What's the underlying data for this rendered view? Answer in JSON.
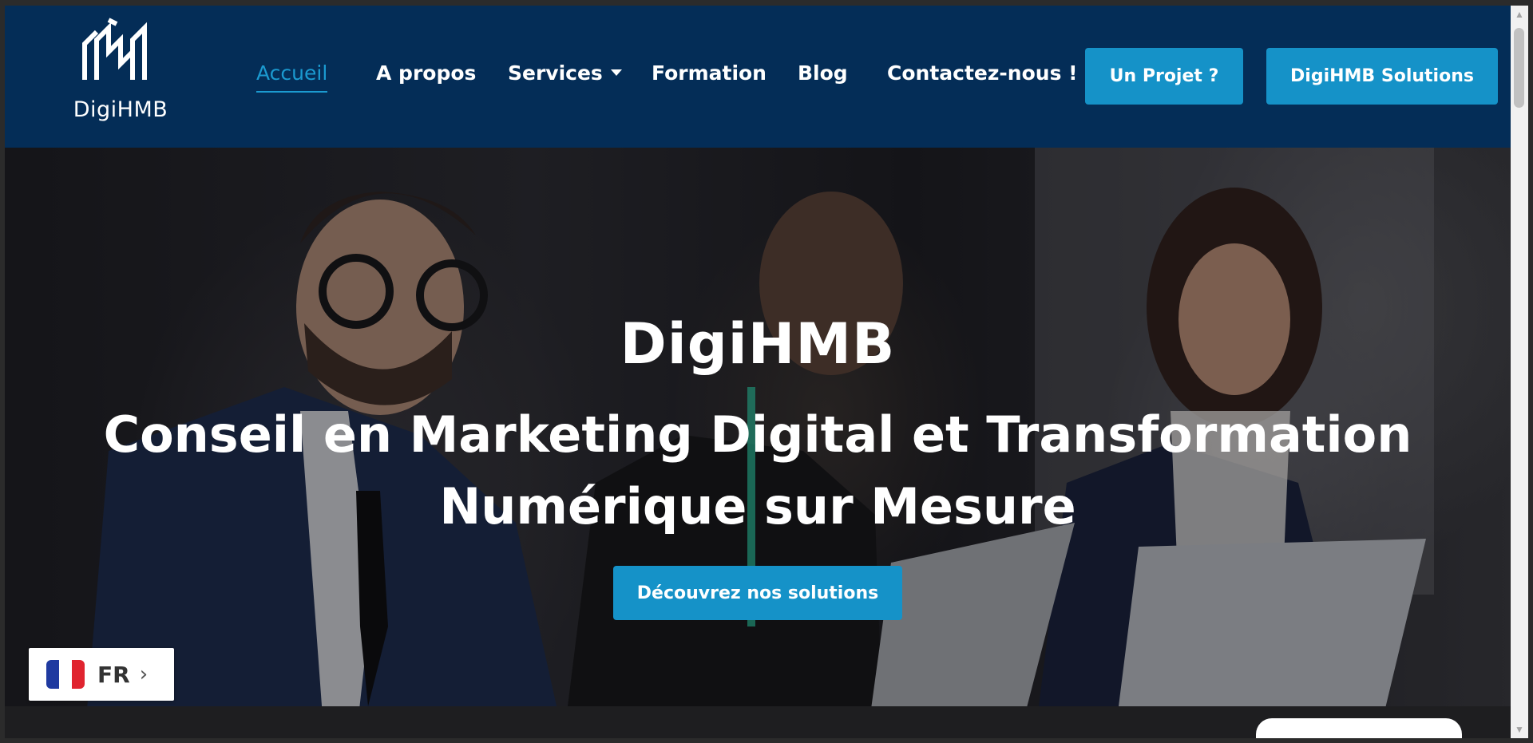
{
  "brand": {
    "name": "DigiHMB"
  },
  "nav": {
    "items": [
      {
        "label": "Accueil",
        "active": true
      },
      {
        "label": "A propos"
      },
      {
        "label": "Services",
        "dropdown": true
      },
      {
        "label": "Formation"
      },
      {
        "label": "Blog"
      },
      {
        "label": "Contactez-nous !"
      }
    ],
    "project_button": "Un Projet ?",
    "solutions_button": "DigiHMB Solutions"
  },
  "hero": {
    "title": "DigiHMB",
    "subtitle_line1": "Conseil en Marketing Digital et Transformation",
    "subtitle_line2": "Numérique sur Mesure",
    "cta": "Découvrez nos solutions"
  },
  "language_switcher": {
    "code": "FR",
    "arrow": "›"
  },
  "colors": {
    "header_bg": "#042d57",
    "accent": "#1592c8",
    "active_link": "#1b9ad0"
  },
  "icons": {
    "logo": "digihmb-logo",
    "flag": "france-flag-icon",
    "caret": "caret-down-icon"
  }
}
